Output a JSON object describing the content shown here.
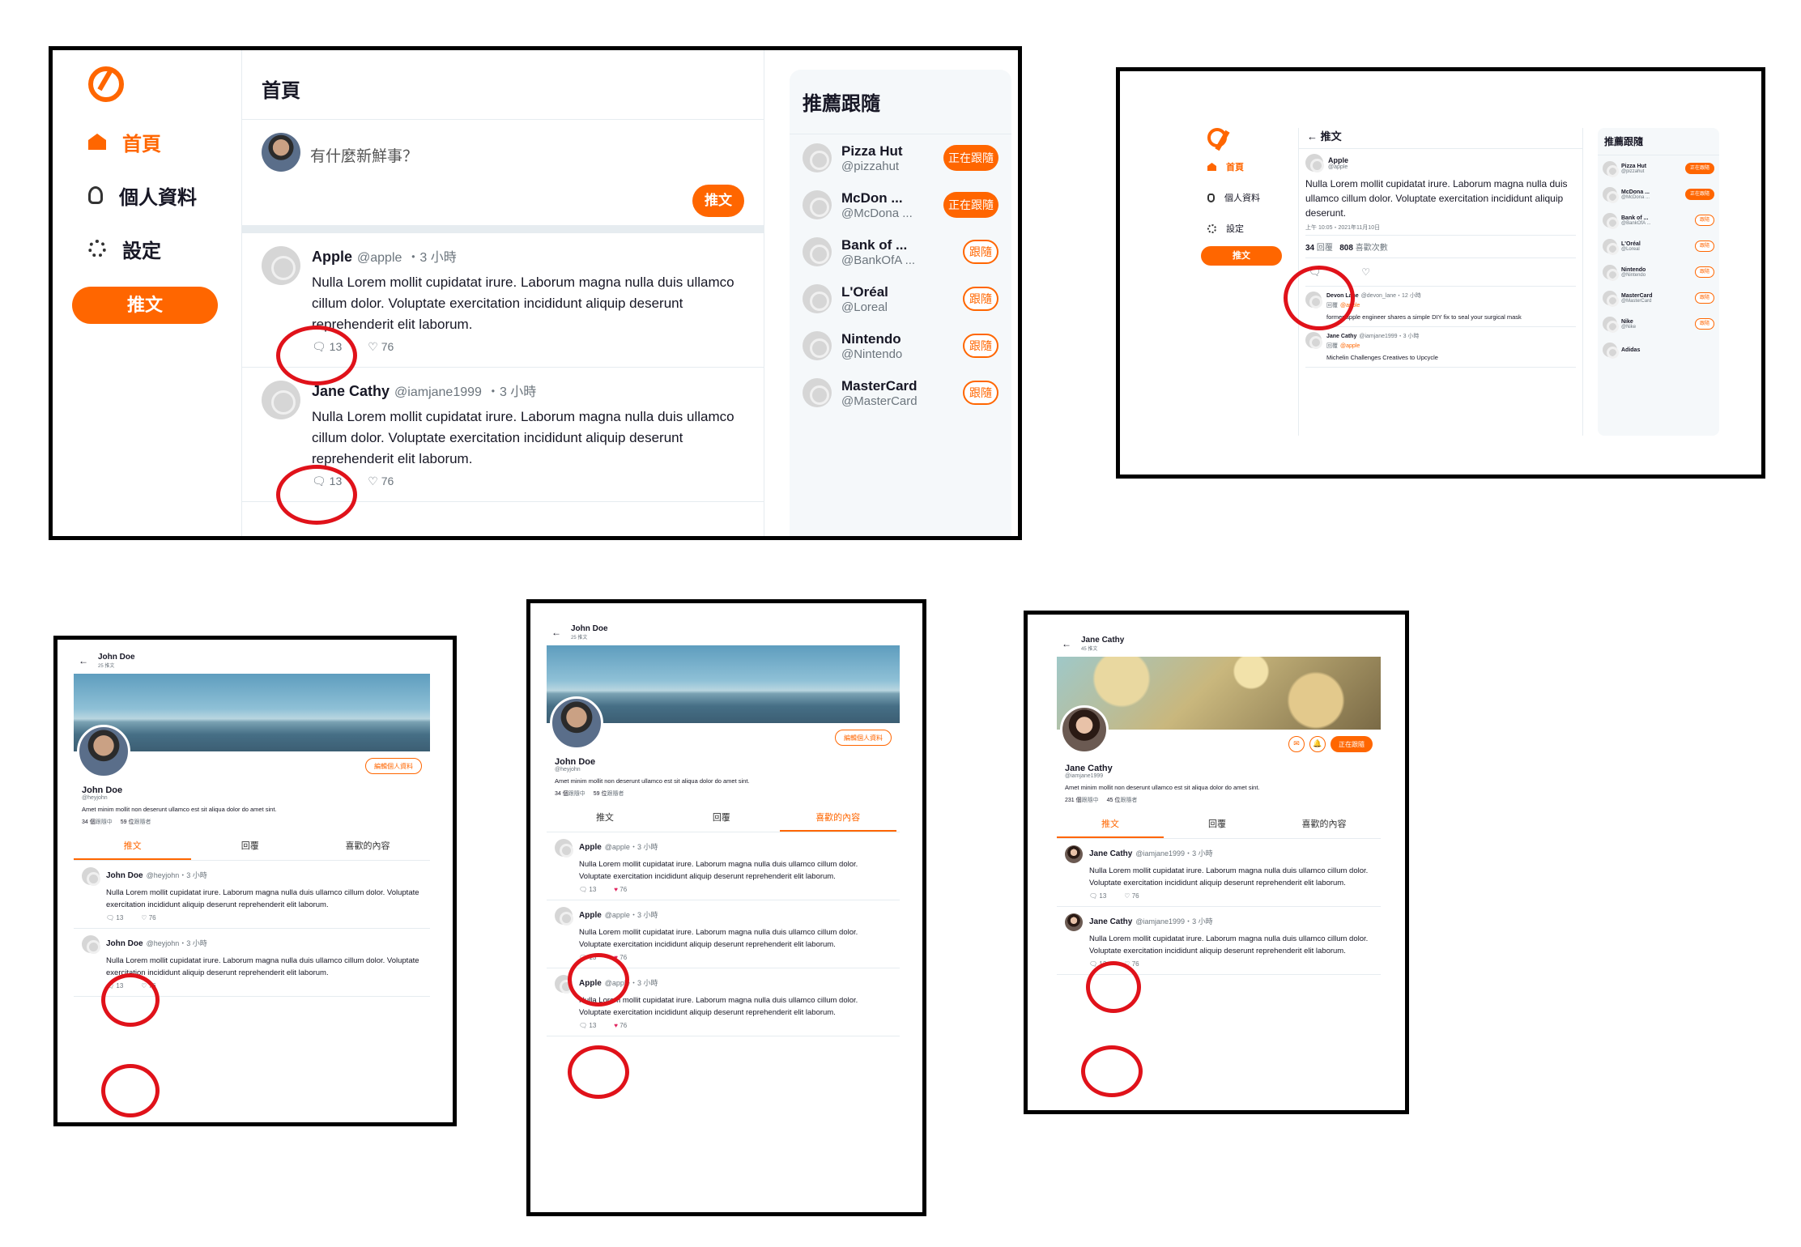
{
  "panel1": {
    "nav": {
      "home": "首頁",
      "profile": "個人資料",
      "settings": "設定",
      "tweet_button": "推文"
    },
    "header_title": "首頁",
    "compose_placeholder": "有什麼新鮮事？",
    "compose_button": "推文",
    "tweets": [
      {
        "name": "Apple",
        "handle": "@apple",
        "time": "3 小時",
        "body": "Nulla Lorem mollit cupidatat irure. Laborum magna nulla duis ullamco cillum dolor. Voluptate exercitation incididunt aliquip deserunt reprehenderit elit laborum.",
        "replies": "13",
        "likes": "76"
      },
      {
        "name": "Jane Cathy",
        "handle": "@iamjane1999",
        "time": "3 小時",
        "body": "Nulla Lorem mollit cupidatat irure. Laborum magna nulla duis ullamco cillum dolor. Voluptate exercitation incididunt aliquip deserunt reprehenderit elit laborum.",
        "replies": "13",
        "likes": "76"
      }
    ],
    "reco_title": "推薦跟隨",
    "reco": [
      {
        "name": "Pizza Hut",
        "handle": "@pizzahut",
        "button": "正在跟隨",
        "following": true
      },
      {
        "name": "McDon ...",
        "handle": "@McDona ...",
        "button": "正在跟隨",
        "following": true
      },
      {
        "name": "Bank of ...",
        "handle": "@BankOfA ...",
        "button": "跟隨",
        "following": false
      },
      {
        "name": "L'Oréal",
        "handle": "@Loreal",
        "button": "跟隨",
        "following": false
      },
      {
        "name": "Nintendo",
        "handle": "@Nintendo",
        "button": "跟隨",
        "following": false
      },
      {
        "name": "MasterCard",
        "handle": "@MasterCard",
        "button": "跟隨",
        "following": false
      }
    ]
  },
  "panel2": {
    "nav": {
      "home": "首頁",
      "profile": "個人資料",
      "settings": "設定",
      "tweet_button": "推文"
    },
    "header_title": "推文",
    "post": {
      "name": "Apple",
      "handle": "@apple",
      "body": "Nulla Lorem mollit cupidatat irure. Laborum magna nulla duis ullamco cillum dolor. Voluptate exercitation incididunt aliquip deserunt.",
      "datetime": "上午 10:05・2021年11月10日",
      "replies_count": "34",
      "replies_label": "回覆",
      "likes_count": "808",
      "likes_label": "喜歡次數"
    },
    "replies": [
      {
        "name": "Devon Lane",
        "handle": "@devon_lane",
        "time": "12 小時",
        "reply_to_label": "回覆",
        "reply_to": "@apple",
        "body": "former apple engineer shares a simple DIY fix to seal your surgical mask"
      },
      {
        "name": "Jane Cathy",
        "handle": "@iamjane1999",
        "time": "3 小時",
        "reply_to_label": "回覆",
        "reply_to": "@apple",
        "body": "Michelin Challenges Creatives to Upcycle"
      }
    ],
    "reco_title": "推薦跟隨",
    "reco": [
      {
        "name": "Pizza Hut",
        "handle": "@pizzahut",
        "button": "正在跟隨",
        "following": true
      },
      {
        "name": "McDona ...",
        "handle": "@McDona ...",
        "button": "正在跟隨",
        "following": true
      },
      {
        "name": "Bank of ...",
        "handle": "@BankOfA ...",
        "button": "跟隨",
        "following": false
      },
      {
        "name": "L'Oréal",
        "handle": "@Loreal",
        "button": "跟隨",
        "following": false
      },
      {
        "name": "Nintendo",
        "handle": "@Nintendo",
        "button": "跟隨",
        "following": false
      },
      {
        "name": "MasterCard",
        "handle": "@MasterCard",
        "button": "跟隨",
        "following": false
      },
      {
        "name": "Nike",
        "handle": "@Nike",
        "button": "跟隨",
        "following": false
      },
      {
        "name": "Adidas",
        "handle": "",
        "button": "",
        "following": false
      }
    ]
  },
  "panel3": {
    "header_name": "John Doe",
    "header_count": "25 推文",
    "name": "John Doe",
    "handle": "@heyjohn",
    "bio": "Amet minim mollit non deserunt ullamco est sit aliqua dolor do amet sint.",
    "following_count": "34 個",
    "following_label": "跟隨中",
    "followers_count": "59 位",
    "followers_label": "跟隨者",
    "edit_button": "編輯個人資料",
    "tabs": [
      "推文",
      "回覆",
      "喜歡的內容"
    ],
    "tweets": [
      {
        "name": "John Doe",
        "handle": "@heyjohn",
        "time": "3 小時",
        "body": "Nulla Lorem mollit cupidatat irure. Laborum magna nulla duis ullamco cillum dolor. Voluptate exercitation incididunt aliquip deserunt reprehenderit elit laborum.",
        "replies": "13",
        "likes": "76"
      },
      {
        "name": "John Doe",
        "handle": "@heyjohn",
        "time": "3 小時",
        "body": "Nulla Lorem mollit cupidatat irure. Laborum magna nulla duis ullamco cillum dolor. Voluptate exercitation incididunt aliquip deserunt reprehenderit elit laborum.",
        "replies": "13",
        "likes": "76"
      }
    ]
  },
  "panel4": {
    "header_name": "John Doe",
    "header_count": "25 推文",
    "name": "John Doe",
    "handle": "@heyjohn",
    "bio": "Amet minim mollit non deserunt ullamco est sit aliqua dolor do amet sint.",
    "following_count": "34 個",
    "following_label": "跟隨中",
    "followers_count": "59 位",
    "followers_label": "跟隨者",
    "edit_button": "編輯個人資料",
    "tabs": [
      "推文",
      "回覆",
      "喜歡的內容"
    ],
    "tweets": [
      {
        "name": "Apple",
        "handle": "@apple",
        "time": "3 小時",
        "body": "Nulla Lorem mollit cupidatat irure. Laborum magna nulla duis ullamco cillum dolor. Voluptate exercitation incididunt aliquip deserunt reprehenderit elit laborum.",
        "replies": "13",
        "likes": "76"
      },
      {
        "name": "Apple",
        "handle": "@apple",
        "time": "3 小時",
        "body": "Nulla Lorem mollit cupidatat irure. Laborum magna nulla duis ullamco cillum dolor. Voluptate exercitation incididunt aliquip deserunt reprehenderit elit laborum.",
        "replies": "13",
        "likes": "76"
      },
      {
        "name": "Apple",
        "handle": "@apple",
        "time": "3 小時",
        "body": "Nulla Lorem mollit cupidatat irure. Laborum magna nulla duis ullamco cillum dolor. Voluptate exercitation incididunt aliquip deserunt reprehenderit elit laborum.",
        "replies": "13",
        "likes": "76"
      }
    ]
  },
  "panel5": {
    "header_name": "Jane Cathy",
    "header_count": "45 推文",
    "name": "Jane Cathy",
    "handle": "@iamjane1999",
    "bio": "Amet minim mollit non deserunt ullamco est sit aliqua dolor do amet sint.",
    "following_count": "231 個",
    "following_label": "跟隨中",
    "followers_count": "45 位",
    "followers_label": "跟隨者",
    "follow_button": "正在跟隨",
    "tabs": [
      "推文",
      "回覆",
      "喜歡的內容"
    ],
    "tweets": [
      {
        "name": "Jane Cathy",
        "handle": "@iamjane1999",
        "time": "3 小時",
        "body": "Nulla Lorem mollit cupidatat irure. Laborum magna nulla duis ullamco cillum dolor. Voluptate exercitation incididunt aliquip deserunt reprehenderit elit laborum.",
        "replies": "13",
        "likes": "76"
      },
      {
        "name": "Jane Cathy",
        "handle": "@iamjane1999",
        "time": "3 小時",
        "body": "Nulla Lorem mollit cupidatat irure. Laborum magna nulla duis ullamco cillum dolor. Voluptate exercitation incididunt aliquip deserunt reprehenderit elit laborum.",
        "replies": "13",
        "likes": "76"
      }
    ]
  },
  "colors": {
    "accent": "#FF6600",
    "highlight_ring": "#e0121a",
    "like_red": "#e0245e"
  }
}
